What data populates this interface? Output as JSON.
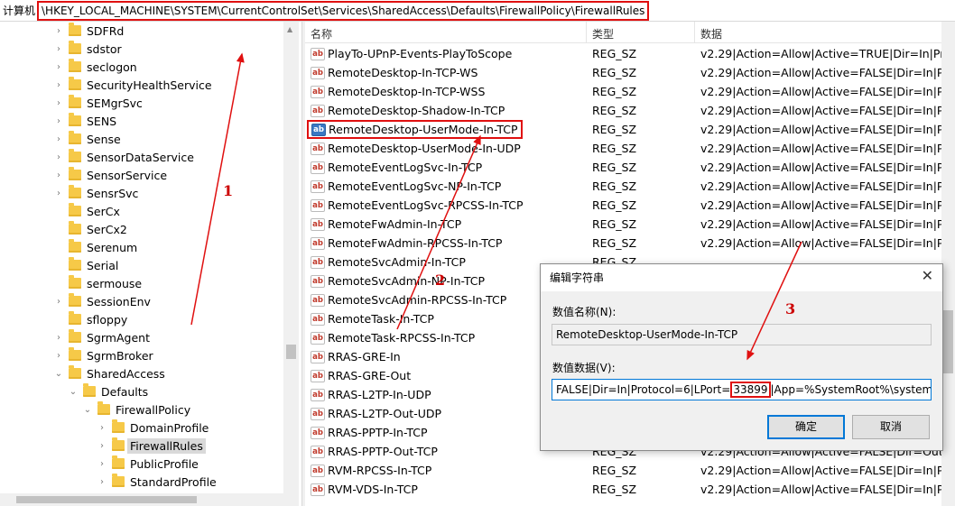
{
  "address": {
    "label": "计算机",
    "path": "\\HKEY_LOCAL_MACHINE\\SYSTEM\\CurrentControlSet\\Services\\SharedAccess\\Defaults\\FirewallPolicy\\FirewallRules"
  },
  "tree": [
    {
      "label": "SDFRd",
      "level": 0,
      "expander": ">"
    },
    {
      "label": "sdstor",
      "level": 0,
      "expander": ">"
    },
    {
      "label": "seclogon",
      "level": 0,
      "expander": ">"
    },
    {
      "label": "SecurityHealthService",
      "level": 0,
      "expander": ">"
    },
    {
      "label": "SEMgrSvc",
      "level": 0,
      "expander": ">"
    },
    {
      "label": "SENS",
      "level": 0,
      "expander": ">"
    },
    {
      "label": "Sense",
      "level": 0,
      "expander": ">"
    },
    {
      "label": "SensorDataService",
      "level": 0,
      "expander": ">"
    },
    {
      "label": "SensorService",
      "level": 0,
      "expander": ">"
    },
    {
      "label": "SensrSvc",
      "level": 0,
      "expander": ">"
    },
    {
      "label": "SerCx",
      "level": 0,
      "expander": ""
    },
    {
      "label": "SerCx2",
      "level": 0,
      "expander": ""
    },
    {
      "label": "Serenum",
      "level": 0,
      "expander": ""
    },
    {
      "label": "Serial",
      "level": 0,
      "expander": ""
    },
    {
      "label": "sermouse",
      "level": 0,
      "expander": ""
    },
    {
      "label": "SessionEnv",
      "level": 0,
      "expander": ">"
    },
    {
      "label": "sfloppy",
      "level": 0,
      "expander": ""
    },
    {
      "label": "SgrmAgent",
      "level": 0,
      "expander": ">"
    },
    {
      "label": "SgrmBroker",
      "level": 0,
      "expander": ">"
    },
    {
      "label": "SharedAccess",
      "level": 0,
      "expander": "v"
    },
    {
      "label": "Defaults",
      "level": 1,
      "expander": "v"
    },
    {
      "label": "FirewallPolicy",
      "level": 2,
      "expander": "v"
    },
    {
      "label": "DomainProfile",
      "level": 3,
      "expander": ">"
    },
    {
      "label": "FirewallRules",
      "level": 3,
      "expander": ">",
      "selected": true
    },
    {
      "label": "PublicProfile",
      "level": 3,
      "expander": ">"
    },
    {
      "label": "StandardProfile",
      "level": 3,
      "expander": ">"
    }
  ],
  "list": {
    "headers": {
      "name": "名称",
      "type": "类型",
      "data": "数据"
    },
    "rows": [
      {
        "name": "PlayTo-UPnP-Events-PlayToScope",
        "type": "REG_SZ",
        "data": "v2.29|Action=Allow|Active=TRUE|Dir=In|Protoc"
      },
      {
        "name": "RemoteDesktop-In-TCP-WS",
        "type": "REG_SZ",
        "data": "v2.29|Action=Allow|Active=FALSE|Dir=In|Proto"
      },
      {
        "name": "RemoteDesktop-In-TCP-WSS",
        "type": "REG_SZ",
        "data": "v2.29|Action=Allow|Active=FALSE|Dir=In|Proto"
      },
      {
        "name": "RemoteDesktop-Shadow-In-TCP",
        "type": "REG_SZ",
        "data": "v2.29|Action=Allow|Active=FALSE|Dir=In|Proto"
      },
      {
        "name": "RemoteDesktop-UserMode-In-TCP",
        "type": "REG_SZ",
        "data": "v2.29|Action=Allow|Active=FALSE|Dir=In|Proto",
        "selected": true
      },
      {
        "name": "RemoteDesktop-UserMode-In-UDP",
        "type": "REG_SZ",
        "data": "v2.29|Action=Allow|Active=FALSE|Dir=In|Proto"
      },
      {
        "name": "RemoteEventLogSvc-In-TCP",
        "type": "REG_SZ",
        "data": "v2.29|Action=Allow|Active=FALSE|Dir=In|Proto"
      },
      {
        "name": "RemoteEventLogSvc-NP-In-TCP",
        "type": "REG_SZ",
        "data": "v2.29|Action=Allow|Active=FALSE|Dir=In|Proto"
      },
      {
        "name": "RemoteEventLogSvc-RPCSS-In-TCP",
        "type": "REG_SZ",
        "data": "v2.29|Action=Allow|Active=FALSE|Dir=In|Proto"
      },
      {
        "name": "RemoteFwAdmin-In-TCP",
        "type": "REG_SZ",
        "data": "v2.29|Action=Allow|Active=FALSE|Dir=In|Proto"
      },
      {
        "name": "RemoteFwAdmin-RPCSS-In-TCP",
        "type": "REG_SZ",
        "data": "v2.29|Action=Allow|Active=FALSE|Dir=In|Proto"
      },
      {
        "name": "RemoteSvcAdmin-In-TCP",
        "type": "REG_SZ",
        "data": ""
      },
      {
        "name": "RemoteSvcAdmin-NP-In-TCP",
        "type": "REG_SZ",
        "data": ""
      },
      {
        "name": "RemoteSvcAdmin-RPCSS-In-TCP",
        "type": "REG_SZ",
        "data": ""
      },
      {
        "name": "RemoteTask-In-TCP",
        "type": "REG_SZ",
        "data": ""
      },
      {
        "name": "RemoteTask-RPCSS-In-TCP",
        "type": "REG_SZ",
        "data": ""
      },
      {
        "name": "RRAS-GRE-In",
        "type": "REG_SZ",
        "data": ""
      },
      {
        "name": "RRAS-GRE-Out",
        "type": "REG_SZ",
        "data": ""
      },
      {
        "name": "RRAS-L2TP-In-UDP",
        "type": "REG_SZ",
        "data": ""
      },
      {
        "name": "RRAS-L2TP-Out-UDP",
        "type": "REG_SZ",
        "data": ""
      },
      {
        "name": "RRAS-PPTP-In-TCP",
        "type": "REG_SZ",
        "data": ""
      },
      {
        "name": "RRAS-PPTP-Out-TCP",
        "type": "REG_SZ",
        "data": "v2.29|Action=Allow|Active=FALSE|Dir=Out|Prot"
      },
      {
        "name": "RVM-RPCSS-In-TCP",
        "type": "REG_SZ",
        "data": "v2.29|Action=Allow|Active=FALSE|Dir=In|Proto"
      },
      {
        "name": "RVM-VDS-In-TCP",
        "type": "REG_SZ",
        "data": "v2.29|Action=Allow|Active=FALSE|Dir=In|Proto"
      }
    ]
  },
  "dialog": {
    "title": "编辑字符串",
    "close": "✕",
    "name_label": "数值名称(N):",
    "name_value": "RemoteDesktop-UserMode-In-TCP",
    "data_label": "数值数据(V):",
    "data_before": "FALSE|Dir=In|Protocol=6|LPort=",
    "data_port": "33899",
    "data_after": "|App=%SystemRoot%\\system32\\s",
    "ok": "确定",
    "cancel": "取消"
  },
  "annotations": {
    "one": "1",
    "two": "2",
    "three": "3"
  },
  "colors": {
    "annotation": "#e01010",
    "selection": "#d9d9d9",
    "focus": "#0078d7"
  }
}
